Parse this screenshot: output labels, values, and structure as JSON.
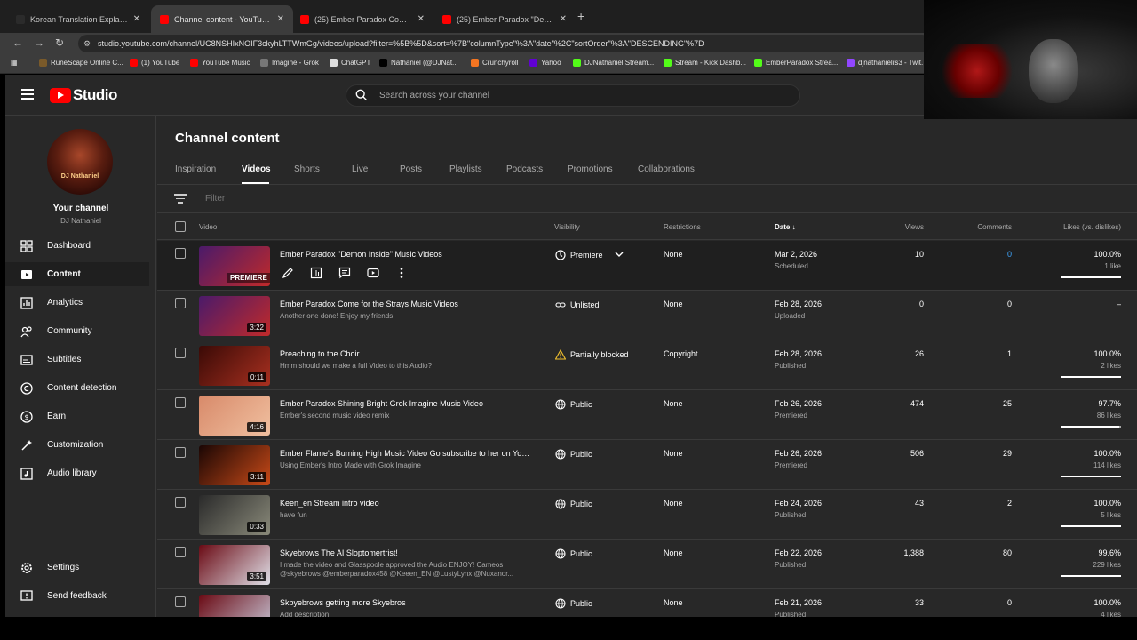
{
  "browser": {
    "tabs": [
      {
        "title": "Korean Translation Explanation",
        "active": false,
        "fav": "#2b2b2b"
      },
      {
        "title": "Channel content - YouTube Studio",
        "active": true,
        "fav": "#ff0000"
      },
      {
        "title": "(25) Ember Paradox Come for the Strays",
        "active": false,
        "fav": "#ff0000"
      },
      {
        "title": "(25) Ember Paradox \"Demon Inside\"",
        "active": false,
        "fav": "#ff0000"
      }
    ],
    "url": "studio.youtube.com/channel/UC8NSHIxNOIF3ckyhLTTWmGg/videos/upload?filter=%5B%5D&sort=%7B\"columnType\"%3A\"date\"%2C\"sortOrder\"%3A\"DESCENDING\"%7D",
    "bookmarks": [
      {
        "label": "RuneScape Online C...",
        "color": "#7a5a2a"
      },
      {
        "label": "(1) YouTube",
        "color": "#ff0000"
      },
      {
        "label": "YouTube Music",
        "color": "#ff0000"
      },
      {
        "label": "Imagine - Grok",
        "color": "#777"
      },
      {
        "label": "ChatGPT",
        "color": "#ddd"
      },
      {
        "label": "Nathaniel (@DJNat...",
        "color": "#000"
      },
      {
        "label": "Crunchyroll",
        "color": "#f47521"
      },
      {
        "label": "Yahoo",
        "color": "#6001d2"
      },
      {
        "label": "DJNathaniel Stream...",
        "color": "#53fc18"
      },
      {
        "label": "Stream - Kick Dashb...",
        "color": "#53fc18"
      },
      {
        "label": "EmberParadox Strea...",
        "color": "#53fc18"
      },
      {
        "label": "djnathanielrs3 - Twit...",
        "color": "#9146ff"
      }
    ]
  },
  "studio": {
    "logo_text": "Studio",
    "search_placeholder": "Search across your channel",
    "channel_name": "Your channel",
    "channel_handle": "DJ Nathaniel",
    "avatar_text": "DJ Nathaniel",
    "nav": [
      {
        "label": "Dashboard",
        "icon": "dashboard-icon"
      },
      {
        "label": "Content",
        "icon": "content-icon",
        "active": true
      },
      {
        "label": "Analytics",
        "icon": "analytics-icon"
      },
      {
        "label": "Community",
        "icon": "community-icon"
      },
      {
        "label": "Subtitles",
        "icon": "subtitles-icon"
      },
      {
        "label": "Content detection",
        "icon": "copyright-icon"
      },
      {
        "label": "Earn",
        "icon": "dollar-icon"
      },
      {
        "label": "Customization",
        "icon": "wand-icon"
      },
      {
        "label": "Audio library",
        "icon": "audio-library-icon"
      }
    ],
    "nav_bottom": [
      {
        "label": "Settings",
        "icon": "gear-icon"
      },
      {
        "label": "Send feedback",
        "icon": "feedback-icon"
      }
    ]
  },
  "content": {
    "title": "Channel content",
    "tabs": [
      "Inspiration",
      "Videos",
      "Shorts",
      "Live",
      "Posts",
      "Playlists",
      "Podcasts",
      "Promotions",
      "Collaborations"
    ],
    "active_tab": "Videos",
    "filter_placeholder": "Filter",
    "columns": {
      "video": "Video",
      "visibility": "Visibility",
      "restrictions": "Restrictions",
      "date": "Date",
      "views": "Views",
      "comments": "Comments",
      "likes": "Likes (vs. dislikes)"
    },
    "premiere_label": "PREMIERE",
    "rows": [
      {
        "title": "Ember Paradox \"Demon Inside\" Music Videos",
        "desc": "",
        "duration": "",
        "visibility": "Premiere",
        "vis_icon": "clock-icon",
        "restrictions": "None",
        "date": "Mar 2, 2026",
        "date_status": "Scheduled",
        "views": "10",
        "comments": "0",
        "likes": "100.0%",
        "likes_sub": "1 like",
        "like_ratio": 1.0,
        "thumb": [
          "#4a1a6a",
          "#c02a2a"
        ]
      },
      {
        "title": "Ember Paradox Come for the Strays Music Videos",
        "desc": "Another one done! Enjoy my friends",
        "duration": "3:22",
        "visibility": "Unlisted",
        "vis_icon": "link-icon",
        "restrictions": "None",
        "date": "Feb 28, 2026",
        "date_status": "Uploaded",
        "views": "0",
        "comments": "0",
        "likes": "–",
        "likes_sub": "",
        "like_ratio": null,
        "thumb": [
          "#4a1a6a",
          "#c02a2a"
        ]
      },
      {
        "title": "Preaching to the Choir",
        "desc": "Hmm should we make a full Video to this Audio?",
        "duration": "0:11",
        "visibility": "Partially blocked",
        "vis_icon": "warning-icon",
        "restrictions": "Copyright",
        "date": "Feb 28, 2026",
        "date_status": "Published",
        "views": "26",
        "comments": "1",
        "likes": "100.0%",
        "likes_sub": "2 likes",
        "like_ratio": 1.0,
        "thumb": [
          "#3a0a06",
          "#a83020"
        ]
      },
      {
        "title": "Ember Paradox Shining Bright Grok Imagine Music Video",
        "desc": "Ember's second music video remix",
        "duration": "4:16",
        "visibility": "Public",
        "vis_icon": "globe-icon",
        "restrictions": "None",
        "date": "Feb 26, 2026",
        "date_status": "Premiered",
        "views": "474",
        "comments": "25",
        "likes": "97.7%",
        "likes_sub": "86 likes",
        "like_ratio": 0.977,
        "thumb": [
          "#d88a6a",
          "#f0c0a0"
        ]
      },
      {
        "title": "Ember Flame's Burning High Music Video Go subscribe to her on YouTu...",
        "desc": "Using Ember's Intro Made with Grok Imagine",
        "duration": "3:11",
        "visibility": "Public",
        "vis_icon": "globe-icon",
        "restrictions": "None",
        "date": "Feb 26, 2026",
        "date_status": "Premiered",
        "views": "506",
        "comments": "29",
        "likes": "100.0%",
        "likes_sub": "114 likes",
        "like_ratio": 1.0,
        "thumb": [
          "#1a0604",
          "#c84a18"
        ]
      },
      {
        "title": "Keen_en Stream intro video",
        "desc": "have fun",
        "duration": "0:33",
        "visibility": "Public",
        "vis_icon": "globe-icon",
        "restrictions": "None",
        "date": "Feb 24, 2026",
        "date_status": "Published",
        "views": "43",
        "comments": "2",
        "likes": "100.0%",
        "likes_sub": "5 likes",
        "like_ratio": 1.0,
        "thumb": [
          "#2a2a2a",
          "#8a8a7a"
        ]
      },
      {
        "title": "Skyebrows The AI Sloptomertrist!",
        "desc": "I made the video and Glasspoole approved the Audio ENJOY! Cameos @skyebrows @emberparadox458 @Keeen_EN @LustyLynx @Nuxanor...",
        "duration": "3:51",
        "visibility": "Public",
        "vis_icon": "globe-icon",
        "restrictions": "None",
        "date": "Feb 22, 2026",
        "date_status": "Published",
        "views": "1,388",
        "comments": "80",
        "likes": "99.6%",
        "likes_sub": "229 likes",
        "like_ratio": 0.996,
        "thumb": [
          "#6a0a14",
          "#e0e0e8"
        ]
      },
      {
        "title": "Skbyebrows getting more Skyebros",
        "desc": "Add description",
        "duration": "",
        "visibility": "Public",
        "vis_icon": "globe-icon",
        "restrictions": "None",
        "date": "Feb 21, 2026",
        "date_status": "Published",
        "views": "33",
        "comments": "0",
        "likes": "100.0%",
        "likes_sub": "4 likes",
        "like_ratio": 1.0,
        "thumb": [
          "#6a0a14",
          "#c8c8d8"
        ]
      }
    ]
  }
}
